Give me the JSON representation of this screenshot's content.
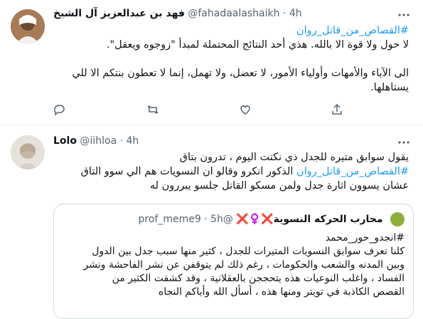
{
  "tweets": [
    {
      "name": "فهد بن عبدالعزيز آل الشيخ",
      "handle": "@fahadaalashaikh",
      "time": "4h",
      "lines": [
        {
          "text": "#القصاص_من_قاتل_روان",
          "hashtag": true
        },
        {
          "text": "لا حول ولا قوة الا بالله. هذي أحد النتائج المحتملة لمبدأ \"زوجوه ويعقل\".",
          "hashtag": false
        },
        {
          "text": "",
          "gap": true
        },
        {
          "text": "الى الآباء والأمهات وأولياء الأمور، لا تعضل، ولا تهمل، إنما لا تعطون بنتكم الا للي",
          "hashtag": false
        },
        {
          "text": "يستاهلها.",
          "hashtag": false
        }
      ]
    },
    {
      "name": "Lolo",
      "handle": "@iihloa",
      "time": "4h",
      "lines": [
        {
          "text": "يقول سوابق متيره للجدل ذي نكتت اليوم ، تدرون بتاق",
          "hashtag": false
        },
        {
          "text": "#القصاص_من_قاتل_روان الذكور انكرو وقالو ان النسويات هم الي سوو التاق",
          "hashtag": false
        },
        {
          "text": "عشان يسوون اثارة جدل ولمن مسكو القاتل جلسو يبررون له",
          "hashtag": false
        }
      ],
      "quote": {
        "name": "محارب الحركه النسوية❌♀️❌",
        "handle": "@prof_meme9",
        "time": "5h",
        "lines": [
          "#انجدو_حور_محمد",
          "كلنا نعرف سوابق النسويات المتيرات للجدل ، كثير منها سبب جدل بين الدول",
          "وبين المدنه والشعب والحكومات ، رغم ذلك لم يتوقفن عن نشر الفاحشة ونشر",
          "الفساد ، واغلب النوعيات هذه يتحججن بالعقلانية ، وقد كشفت الكثير من",
          "القصص الكاذبة في تويتر ومنها هذه ، أسأل الله وأياكم النجاه"
        ]
      }
    }
  ],
  "dot": "·",
  "icons": {
    "more": "more-horizontal-icon",
    "reply": "reply-icon",
    "retweet": "retweet-icon",
    "like": "heart-icon",
    "share": "share-icon"
  },
  "colors": {
    "hashtag": "#1d9bf0",
    "secondary": "#536471",
    "border": "#eff3f4"
  }
}
